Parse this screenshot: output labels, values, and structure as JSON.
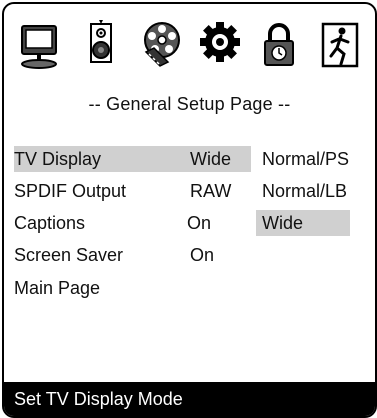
{
  "toolbar": {
    "icons": [
      {
        "name": "monitor-icon"
      },
      {
        "name": "speaker-icon"
      },
      {
        "name": "film-reel-icon"
      },
      {
        "name": "gear-icon"
      },
      {
        "name": "padlock-icon"
      },
      {
        "name": "exit-icon"
      }
    ]
  },
  "page_title": "-- General Setup Page --",
  "menu": {
    "items": [
      {
        "label": "TV Display",
        "value": "Wide"
      },
      {
        "label": "SPDIF Output",
        "value": "RAW"
      },
      {
        "label": "Captions",
        "value": "On"
      },
      {
        "label": "Screen Saver",
        "value": "On"
      },
      {
        "label": "Main Page"
      }
    ],
    "selected_item": "TV Display"
  },
  "options": {
    "items": [
      "Normal/PS",
      "Normal/LB",
      "Wide"
    ],
    "selected": "Wide"
  },
  "status_text": "Set TV Display Mode",
  "colors": {
    "highlight": "#d0d0d0",
    "status_bar_bg": "#000000",
    "status_bar_text": "#ffffff"
  }
}
